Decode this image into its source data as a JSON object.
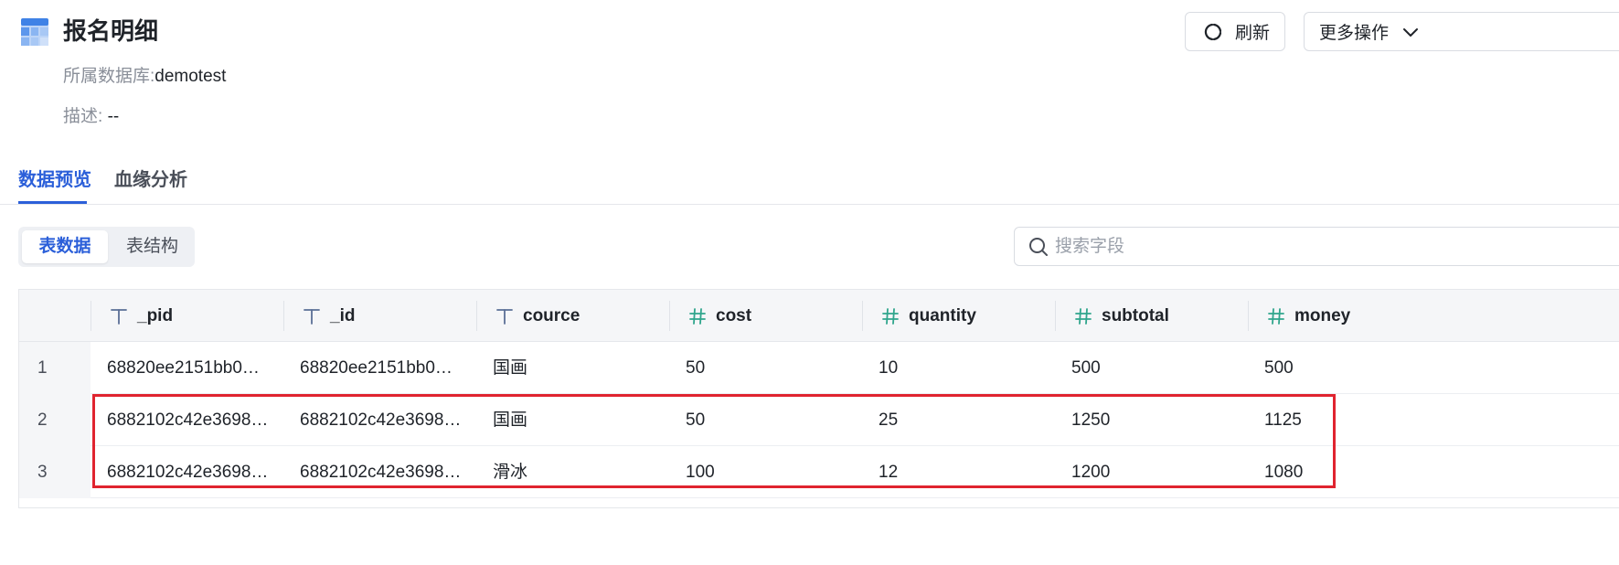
{
  "header": {
    "title": "报名明细",
    "db_label": "所属数据库:",
    "db_value": "demotest",
    "desc_label": "描述:",
    "desc_value": "--",
    "refresh_label": "刷新",
    "more_label": "更多操作"
  },
  "tabs": [
    {
      "label": "数据预览",
      "active": true
    },
    {
      "label": "血缘分析",
      "active": false
    }
  ],
  "segment": {
    "data_label": "表数据",
    "struct_label": "表结构"
  },
  "search": {
    "placeholder": "搜索字段"
  },
  "table": {
    "columns": [
      {
        "name": "_pid",
        "type_icon": "text-type-icon"
      },
      {
        "name": "_id",
        "type_icon": "text-type-icon"
      },
      {
        "name": "cource",
        "type_icon": "text-type-icon"
      },
      {
        "name": "cost",
        "type_icon": "number-type-icon"
      },
      {
        "name": "quantity",
        "type_icon": "number-type-icon"
      },
      {
        "name": "subtotal",
        "type_icon": "number-type-icon"
      },
      {
        "name": "money",
        "type_icon": "number-type-icon"
      }
    ],
    "rows": [
      {
        "num": "1",
        "cells": [
          "68820ee2151bb0…",
          "68820ee2151bb0…",
          "国画",
          "50",
          "10",
          "500",
          "500"
        ]
      },
      {
        "num": "2",
        "cells": [
          "6882102c42e3698…",
          "6882102c42e3698…",
          "国画",
          "50",
          "25",
          "1250",
          "1125"
        ]
      },
      {
        "num": "3",
        "cells": [
          "6882102c42e3698…",
          "6882102c42e3698…",
          "滑冰",
          "100",
          "12",
          "1200",
          "1080"
        ]
      }
    ]
  },
  "colors": {
    "accent": "#2b5fd9",
    "highlight": "#e0242f",
    "number_icon": "#2fa58c"
  }
}
